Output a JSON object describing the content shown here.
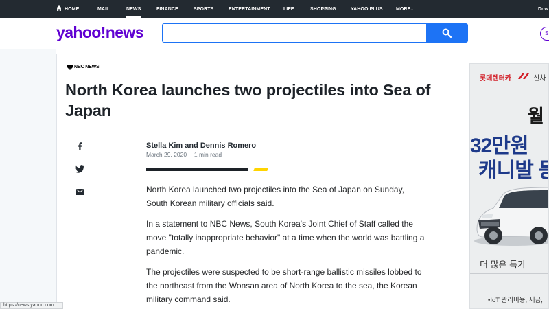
{
  "nav": {
    "items": [
      {
        "label": "HOME"
      },
      {
        "label": "MAIL"
      },
      {
        "label": "NEWS"
      },
      {
        "label": "FINANCE"
      },
      {
        "label": "SPORTS"
      },
      {
        "label": "ENTERTAINMENT"
      },
      {
        "label": "LIFE"
      },
      {
        "label": "SHOPPING"
      },
      {
        "label": "YAHOO PLUS"
      },
      {
        "label": "MORE..."
      },
      {
        "label": "Dow"
      }
    ],
    "active": "NEWS"
  },
  "header": {
    "logo": "yahoo!news",
    "search": {
      "value": "",
      "placeholder": ""
    },
    "right_pill": "S"
  },
  "article": {
    "source": "NBC NEWS",
    "headline": "North Korea launches two projectiles into Sea of Japan",
    "authors": "Stella Kim and Dennis Romero",
    "date": "March 29, 2020",
    "read_time": "1 min read",
    "paragraphs": [
      "North Korea launched two projectiles into the Sea of Japan on Sunday, South Korean military officials said.",
      "In a statement to NBC News, South Korea's Joint Chief of Staff called the move \"totally inappropriate behavior\" at a time when the world was battling a pandemic.",
      "The projectiles were suspected to be short-range ballistic missiles lobbed to the northeast from the Wonsan area of North Korea to the sea, the Korean military command said."
    ]
  },
  "share": {
    "facebook": "facebook-icon",
    "twitter": "twitter-icon",
    "email": "mail-icon"
  },
  "ad": {
    "brand": "롯데렌터카",
    "brand_sub": "신차",
    "big1": "월",
    "big2": "32만원",
    "big3": "캐니발 등",
    "more": "더 많은 특가",
    "footer": "•IoT 관리비용, 세금,"
  },
  "statusbar": "https://news.yahoo.com",
  "colors": {
    "brand": "#6001d2",
    "search": "#1d73f5",
    "nav_bg": "#232a31",
    "accent_yellow": "#ffd400"
  }
}
